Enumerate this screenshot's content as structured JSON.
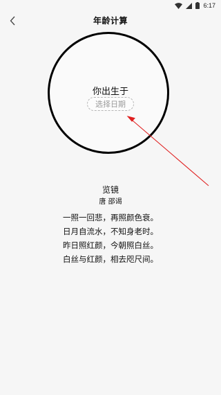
{
  "status_bar": {
    "time": "6:17"
  },
  "header": {
    "title": "年龄计算"
  },
  "main": {
    "born_label": "你出生于",
    "date_button": "选择日期"
  },
  "poem": {
    "title": "览镜",
    "author": "唐 邵谒",
    "lines": [
      "一照一回悲，再照颜色衰。",
      "日月自流水，不知身老时。",
      "昨日照红颜，今朝照白丝。",
      "白丝与红颜，相去咫尺间。"
    ]
  },
  "colors": {
    "arrow": "#e02020",
    "circle": "#000000",
    "background": "#f6f6f6"
  }
}
